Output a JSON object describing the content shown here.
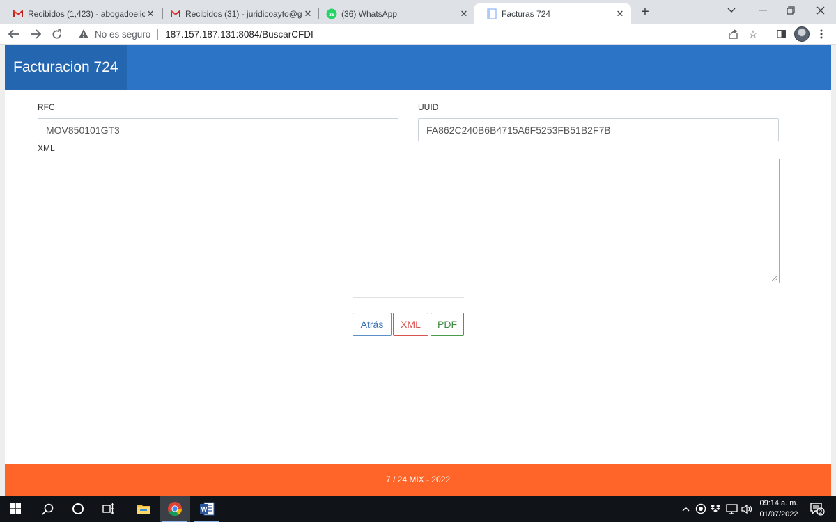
{
  "browser": {
    "tabs": [
      {
        "title": "Recibidos (1,423) - abogadoelico",
        "icon": "gmail-icon",
        "active": false
      },
      {
        "title": "Recibidos (31) - juridicoayto@gm",
        "icon": "gmail-icon",
        "active": false
      },
      {
        "title": "(36) WhatsApp",
        "icon": "whatsapp-icon",
        "badge": "36",
        "active": false
      },
      {
        "title": "Facturas 724",
        "icon": "page-icon",
        "active": true
      }
    ],
    "not_secure_label": "No es seguro",
    "url": "187.157.187.131:8084/BuscarCFDI"
  },
  "page": {
    "brand": "Facturacion 724",
    "form": {
      "rfc_label": "RFC",
      "rfc_value": "MOV850101GT3",
      "uuid_label": "UUID",
      "uuid_value": "FA862C240B6B4715A6F5253FB51B2F7B",
      "xml_label": "XML",
      "xml_value": ""
    },
    "buttons": {
      "back": "Atrás",
      "xml": "XML",
      "pdf": "PDF"
    },
    "footer": "7 / 24 MIX - 2022"
  },
  "taskbar": {
    "time": "09:14 a. m.",
    "date": "01/07/2022",
    "notification_count": "2"
  },
  "colors": {
    "header": "#2b74c6",
    "brand_bg": "#2566b0",
    "footer": "#ff6529",
    "back_button": "#3a70b0",
    "xml_button": "#d9534f",
    "pdf_button": "#3d8b3d"
  }
}
